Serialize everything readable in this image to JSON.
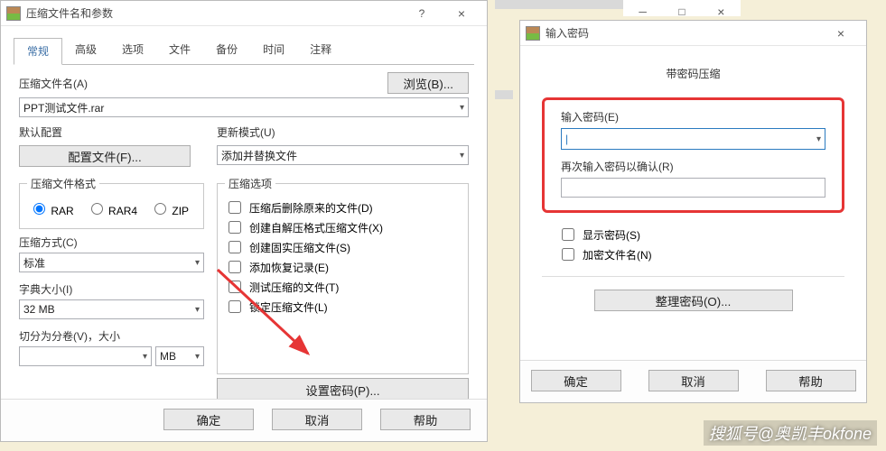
{
  "main": {
    "title": "压缩文件名和参数",
    "tabs": [
      "常规",
      "高级",
      "选项",
      "文件",
      "备份",
      "时间",
      "注释"
    ],
    "archive_name_label": "压缩文件名(A)",
    "browse_btn": "浏览(B)...",
    "archive_name_value": "PPT测试文件.rar",
    "default_profile_label": "默认配置",
    "profile_btn": "配置文件(F)...",
    "update_mode_label": "更新模式(U)",
    "update_mode_value": "添加并替换文件",
    "format_legend": "压缩文件格式",
    "format_options": [
      "RAR",
      "RAR4",
      "ZIP"
    ],
    "method_label": "压缩方式(C)",
    "method_value": "标准",
    "dict_label": "字典大小(I)",
    "dict_value": "32 MB",
    "split_label": "切分为分卷(V)，大小",
    "split_unit": "MB",
    "options_legend": "压缩选项",
    "options": [
      "压缩后删除原来的文件(D)",
      "创建自解压格式压缩文件(X)",
      "创建固实压缩文件(S)",
      "添加恢复记录(E)",
      "测试压缩的文件(T)",
      "锁定压缩文件(L)"
    ],
    "set_password_btn": "设置密码(P)...",
    "ok": "确定",
    "cancel": "取消",
    "help": "帮助"
  },
  "pwd": {
    "title": "输入密码",
    "subtitle": "带密码压缩",
    "enter_label": "输入密码(E)",
    "reenter_label": "再次输入密码以确认(R)",
    "show_label": "显示密码(S)",
    "encrypt_label": "加密文件名(N)",
    "organize_btn": "整理密码(O)...",
    "ok": "确定",
    "cancel": "取消",
    "help": "帮助"
  },
  "watermark": "搜狐号@奥凯丰okfone"
}
